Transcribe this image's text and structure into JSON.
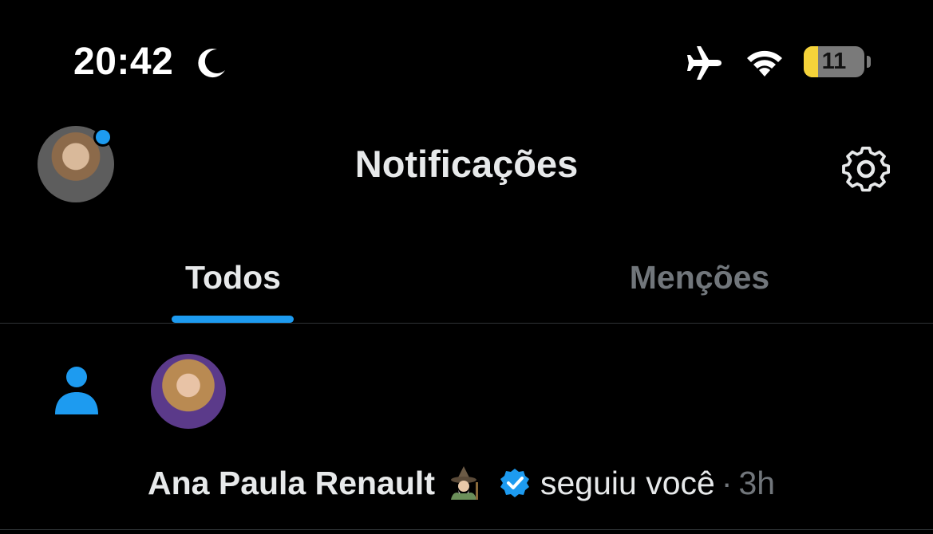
{
  "status_bar": {
    "time": "20:42",
    "battery_level": "11",
    "battery_fraction": 0.11,
    "battery_color": "#f5d33a",
    "icons": [
      "moon-icon",
      "airplane-icon",
      "wifi-icon",
      "battery-icon"
    ]
  },
  "header": {
    "title": "Notificações",
    "has_unread_dot": true,
    "accent_color": "#1d9bf0",
    "icons": [
      "avatar",
      "gear-icon"
    ]
  },
  "tabs": [
    {
      "label": "Todos",
      "active": true
    },
    {
      "label": "Menções",
      "active": false
    }
  ],
  "notifications": [
    {
      "type_icon": "person-icon",
      "user_name": "Ana Paula Renault",
      "name_emoji_icon": "wizard-emoji-icon",
      "verified": true,
      "action": "seguiu você",
      "separator": "·",
      "time": "3h"
    }
  ]
}
